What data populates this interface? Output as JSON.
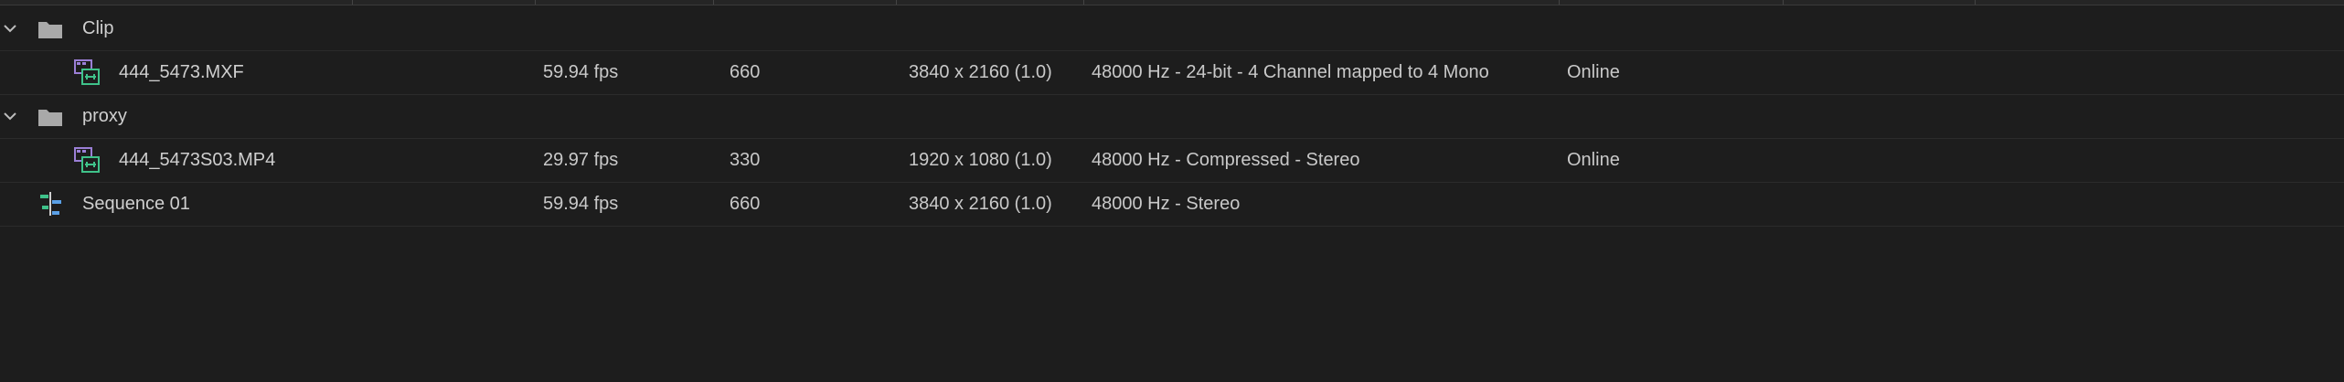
{
  "rows": [
    {
      "name": "Clip",
      "frame_rate": "",
      "duration": "",
      "video_info": "",
      "audio_info": "",
      "status": "",
      "icon": "folder-icon"
    },
    {
      "name": "444_5473.MXF",
      "frame_rate": "59.94 fps",
      "duration": "660",
      "video_info": "3840 x 2160 (1.0)",
      "audio_info": "48000 Hz - 24-bit - 4 Channel mapped to 4 Mono",
      "status": "Online",
      "icon": "video-clip-icon"
    },
    {
      "name": "proxy",
      "frame_rate": "",
      "duration": "",
      "video_info": "",
      "audio_info": "",
      "status": "",
      "icon": "folder-icon"
    },
    {
      "name": "444_5473S03.MP4",
      "frame_rate": "29.97 fps",
      "duration": "330",
      "video_info": "1920 x 1080 (1.0)",
      "audio_info": "48000 Hz - Compressed - Stereo",
      "status": "Online",
      "icon": "video-clip-icon"
    },
    {
      "name": "Sequence 01",
      "frame_rate": "59.94 fps",
      "duration": "660",
      "video_info": "3840 x 2160 (1.0)",
      "audio_info": "48000 Hz - Stereo",
      "status": "",
      "icon": "sequence-icon"
    }
  ],
  "colors": {
    "background": "#1d1d1d",
    "text": "#c9c9c9",
    "folder": "#a9a9a9",
    "clip_purple": "#9b7fd6",
    "clip_green": "#3fc28a",
    "sequence_green": "#3fc28a",
    "sequence_blue": "#5aa0e6"
  }
}
